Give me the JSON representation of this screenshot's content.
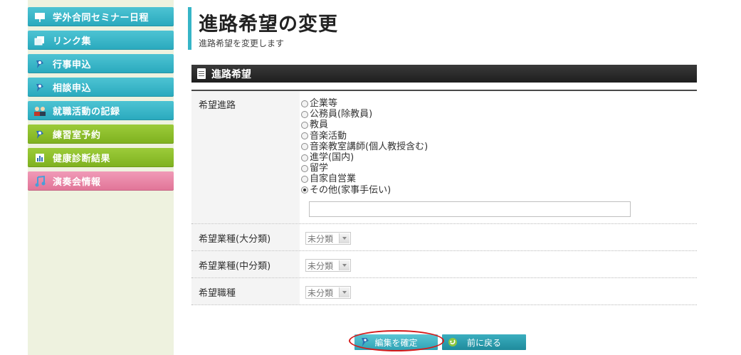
{
  "sidebar": {
    "items": [
      {
        "label": "学外合同セミナー日程",
        "icon": "presentation-board-icon",
        "color": "#36b5c7"
      },
      {
        "label": "リンク集",
        "icon": "link-pages-icon",
        "color": "#36b5c7"
      },
      {
        "label": "行事申込",
        "icon": "pin-icon",
        "color": "#36b5c7"
      },
      {
        "label": "相談申込",
        "icon": "pin-icon",
        "color": "#36b5c7"
      },
      {
        "label": "就職活動の記録",
        "icon": "people-icon",
        "color": "#36b5c7"
      },
      {
        "label": "練習室予約",
        "icon": "pin-icon",
        "color": "#8bbd2a"
      },
      {
        "label": "健康診断結果",
        "icon": "bar-report-icon",
        "color": "#8bbd2a"
      },
      {
        "label": "演奏会情報",
        "icon": "music-note-icon",
        "color": "#e8819f"
      }
    ]
  },
  "header": {
    "title": "進路希望の変更",
    "subtitle": "進路希望を変更します"
  },
  "section": {
    "title": "進路希望"
  },
  "form": {
    "course": {
      "label": "希望進路",
      "options": [
        "企業等",
        "公務員(除教員)",
        "教員",
        "音楽活動",
        "音楽教室講師(個人教授含む)",
        "進学(国内)",
        "留学",
        "自家自営業",
        "その他(家事手伝い)"
      ],
      "selected_index": 8,
      "other_value": ""
    },
    "industry_major": {
      "label": "希望業種(大分類)",
      "value": "未分類"
    },
    "industry_middle": {
      "label": "希望業種(中分類)",
      "value": "未分類"
    },
    "job": {
      "label": "希望職種",
      "value": "未分類"
    }
  },
  "actions": {
    "confirm_label": "編集を確定",
    "back_label": "前に戻る"
  },
  "colors": {
    "accent": "#36b5c7",
    "highlight": "#d41a1a"
  }
}
